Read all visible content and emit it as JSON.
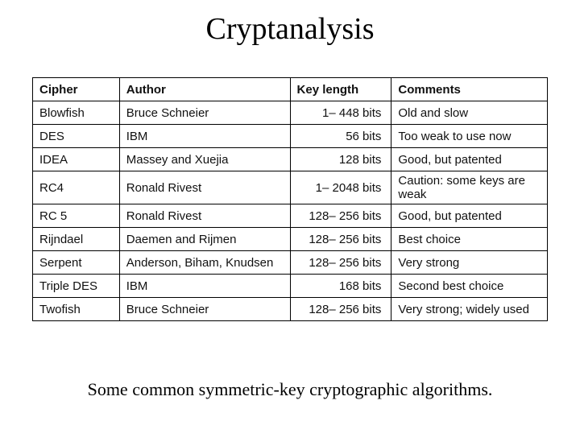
{
  "title": "Cryptanalysis",
  "caption": "Some common symmetric-key cryptographic algorithms.",
  "chart_data": {
    "type": "table",
    "columns": [
      "Cipher",
      "Author",
      "Key length",
      "Comments"
    ],
    "rows": [
      {
        "cipher": "Blowfish",
        "author": "Bruce Schneier",
        "key_length": "1– 448 bits",
        "comments": "Old and slow"
      },
      {
        "cipher": "DES",
        "author": "IBM",
        "key_length": "56 bits",
        "comments": "Too weak to use now"
      },
      {
        "cipher": "IDEA",
        "author": "Massey and Xuejia",
        "key_length": "128 bits",
        "comments": "Good, but patented"
      },
      {
        "cipher": "RC4",
        "author": "Ronald Rivest",
        "key_length": "1– 2048 bits",
        "comments": "Caution: some keys are weak"
      },
      {
        "cipher": "RC 5",
        "author": "Ronald Rivest",
        "key_length": "128– 256 bits",
        "comments": "Good, but patented"
      },
      {
        "cipher": "Rijndael",
        "author": "Daemen and Rijmen",
        "key_length": "128– 256 bits",
        "comments": "Best choice"
      },
      {
        "cipher": "Serpent",
        "author": "Anderson, Biham, Knudsen",
        "key_length": "128– 256 bits",
        "comments": "Very strong"
      },
      {
        "cipher": "Triple DES",
        "author": "IBM",
        "key_length": "168 bits",
        "comments": "Second best choice"
      },
      {
        "cipher": "Twofish",
        "author": "Bruce Schneier",
        "key_length": "128– 256 bits",
        "comments": "Very strong; widely used"
      }
    ]
  }
}
